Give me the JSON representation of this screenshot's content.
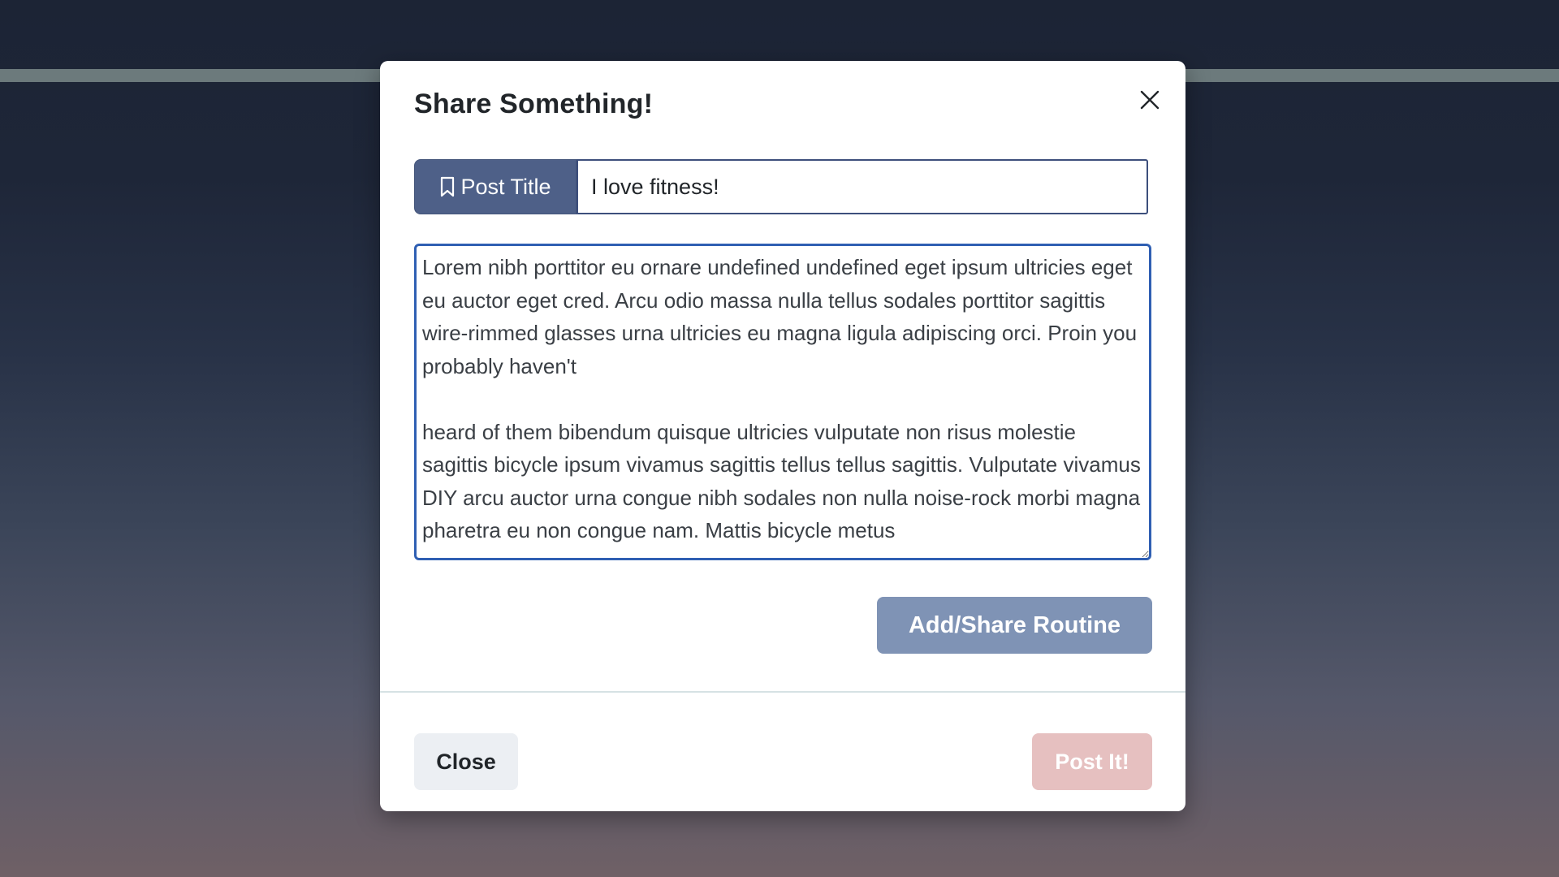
{
  "modal": {
    "title": "Share Something!",
    "close_icon": "close-icon",
    "title_field": {
      "label": "Post Title",
      "icon": "bookmark-icon",
      "value": "I love fitness!"
    },
    "body_field": {
      "value": "Lorem nibh porttitor eu ornare undefined undefined eget ipsum ultricies eget eu auctor eget cred. Arcu odio massa nulla tellus sodales porttitor sagittis wire-rimmed glasses urna ultricies eu magna ligula adipiscing orci. Proin you probably haven't\n\nheard of them bibendum quisque ultricies vulputate non risus molestie sagittis bicycle ipsum vivamus sagittis tellus tellus sagittis. Vulputate vivamus DIY arcu auctor urna congue nibh sodales non nulla noise-rock morbi magna pharetra eu non congue nam. Mattis bicycle metus"
    },
    "add_share_button": "Add/Share Routine",
    "close_button": "Close",
    "post_button": "Post It!"
  },
  "colors": {
    "label_bg": "#4e6088",
    "focus_border": "#2f5fb3",
    "add_share_bg": "#7f93b5",
    "post_bg": "#e6c0c0",
    "close_bg": "#eceff3"
  }
}
